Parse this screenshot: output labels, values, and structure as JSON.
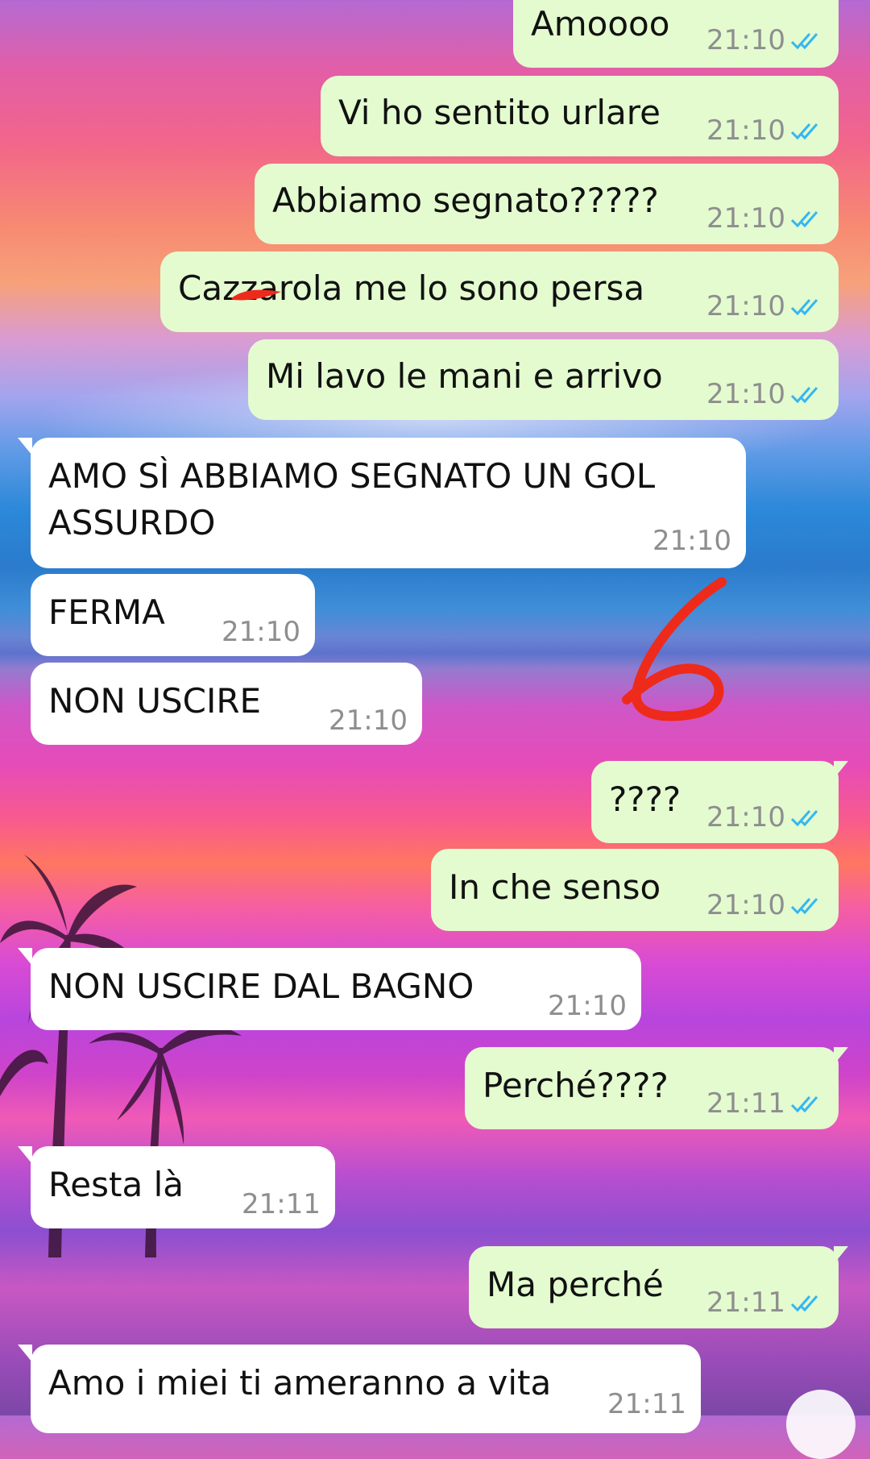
{
  "chat": {
    "messages": [
      {
        "dir": "out",
        "text": "Amoooo",
        "time": "21:10"
      },
      {
        "dir": "out",
        "text": "Vi ho sentito urlare",
        "time": "21:10"
      },
      {
        "dir": "out",
        "text": "Abbiamo segnato?????",
        "time": "21:10"
      },
      {
        "dir": "out",
        "text": "Cazzarola me lo sono persa",
        "time": "21:10"
      },
      {
        "dir": "out",
        "text": "Mi lavo le mani e arrivo",
        "time": "21:10"
      },
      {
        "dir": "in",
        "text_line1": "AMO SÌ ABBIAMO SEGNATO UN GOL",
        "text_line2": "ASSURDO",
        "time": "21:10"
      },
      {
        "dir": "in",
        "text": "FERMA",
        "time": "21:10"
      },
      {
        "dir": "in",
        "text": "NON USCIRE",
        "time": "21:10"
      },
      {
        "dir": "out",
        "text": "????",
        "time": "21:10"
      },
      {
        "dir": "out",
        "text": "In che senso",
        "time": "21:10"
      },
      {
        "dir": "in",
        "text": "NON USCIRE DAL BAGNO",
        "time": "21:10"
      },
      {
        "dir": "out",
        "text": "Perché????",
        "time": "21:11"
      },
      {
        "dir": "in",
        "text": "Resta là",
        "time": "21:11"
      },
      {
        "dir": "out",
        "text": "Ma perché",
        "time": "21:11"
      },
      {
        "dir": "in",
        "text": "Amo i miei ti ameranno a vita",
        "time": "21:11"
      }
    ],
    "annotation": "6"
  },
  "colors": {
    "outgoing_bubble": "#e3fbcf",
    "incoming_bubble": "#ffffff",
    "read_check": "#34b7f1",
    "scribble": "#ee2a1b"
  }
}
